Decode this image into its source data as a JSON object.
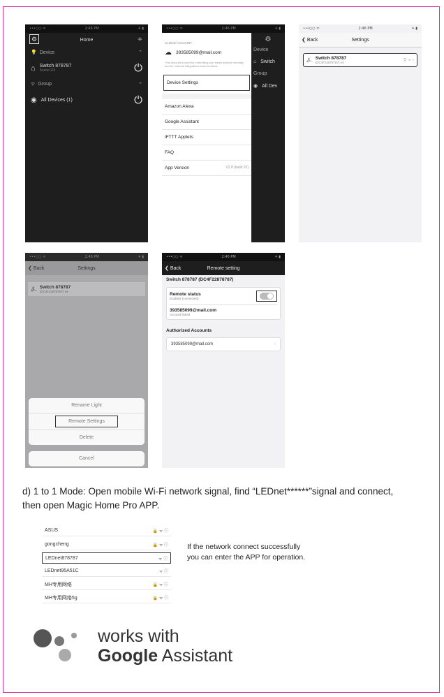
{
  "phone1": {
    "title": "Home",
    "plus": "+",
    "device_section": "Device",
    "device_name": "Switch 878787",
    "device_sub": "Scene:2/4",
    "group_section": "Group",
    "group_name": "All Devices (1)"
  },
  "phone2": {
    "cloud_account_label": "CLOUD ACCOUNT",
    "email": "393585099@mail.com",
    "info": "This Account is used for controlling your smart devices remotely and for external integrations such as Alexa.",
    "items": [
      "Device Settings",
      "Amazon Alexa",
      "Google Assistant",
      "IFTTT Applets",
      "FAQ",
      "App Version"
    ],
    "app_version": "V2.8 (build 20)",
    "behind_device": "Device",
    "behind_switch": "Switch",
    "behind_group": "Group",
    "behind_all": "All Dev"
  },
  "phone3": {
    "back": "Back",
    "title": "Settings",
    "device_name": "Switch 878787",
    "device_id": "(DC4F22878787) v4"
  },
  "phone4": {
    "back": "Back",
    "title": "Settings",
    "device_name": "Switch 878787",
    "device_id": "(DC4F22878787) v4",
    "actions": [
      "Rename Light",
      "Remote Settings",
      "Delete"
    ],
    "cancel": "Cancel"
  },
  "phone5": {
    "back": "Back",
    "title": "Remote setting",
    "header": "Switch 878787 (DC4F22878787)",
    "remote_status": "Remote status",
    "remote_status_sub": "Enabled (connected)",
    "email": "393585099@mail.com",
    "email_sub": "Account linked",
    "authorized_label": "Authorized Accounts",
    "authorized_email": "393585099@mail.com"
  },
  "caption": "d) 1 to 1 Mode: Open mobile Wi-Fi network signal, find “LEDnet******”signal and connect, then open Magic Home Pro APP.",
  "wifi": [
    "ASUS",
    "gongcheng",
    "LEDnet878787",
    "LEDnet95A51C",
    "MH专用网络",
    "MH专用网络5g"
  ],
  "wifi_note": [
    "If the network connect successfully",
    "you can enter the APP for operation."
  ],
  "google": {
    "line1": "works with",
    "brand": "Google",
    "rest": " Assistant"
  },
  "colors": {
    "frame": "#d63aa0",
    "dark_bg": "#1e1e1e"
  }
}
